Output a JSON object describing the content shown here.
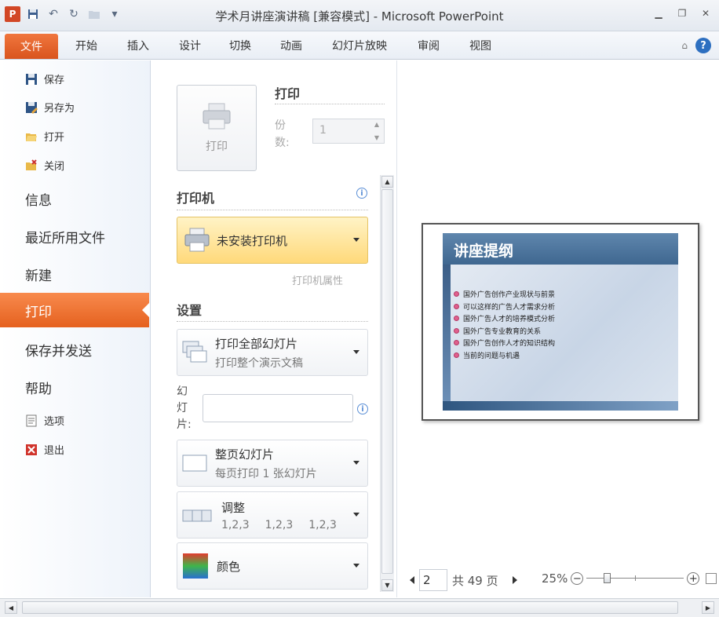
{
  "window": {
    "title": "学术月讲座演讲稿 [兼容模式] - Microsoft PowerPoint",
    "logo_letter": "P"
  },
  "ribbon": {
    "tabs": [
      "文件",
      "开始",
      "插入",
      "设计",
      "切换",
      "动画",
      "幻灯片放映",
      "审阅",
      "视图"
    ]
  },
  "nav": {
    "save": "保存",
    "save_as": "另存为",
    "open": "打开",
    "close": "关闭",
    "info": "信息",
    "recent": "最近所用文件",
    "new": "新建",
    "print": "打印",
    "save_send": "保存并发送",
    "help": "帮助",
    "options": "选项",
    "exit": "退出"
  },
  "print": {
    "button_label": "打印",
    "section_title": "打印",
    "copies_label": "份数:",
    "copies_value": "1",
    "printer_title": "打印机",
    "printer_name": "未安装打印机",
    "printer_props": "打印机属性",
    "settings_title": "设置",
    "range_l1": "打印全部幻灯片",
    "range_l2": "打印整个演示文稿",
    "slides_label": "幻灯片:",
    "slides_value": "",
    "layout_l1": "整页幻灯片",
    "layout_l2": "每页打印 1 张幻灯片",
    "collate_l1": "调整",
    "collate_seq": [
      "1,2,3",
      "1,2,3",
      "1,2,3"
    ],
    "color_l1": "颜色"
  },
  "preview": {
    "slide_title": "讲座提纲",
    "bullets": [
      "国外广告创作产业现状与前景",
      "可以这样的广告人才需求分析",
      "国外广告人才的培养模式分析",
      "国外广告专业教育的关系",
      "国外广告创作人才的知识结构",
      "当前的问题与机遇"
    ],
    "current_page": "2",
    "total_pages": "共 49 页",
    "zoom": "25%",
    "zoom_fraction": 0.25
  },
  "colors": {
    "file_tab": "#e05a22",
    "printer_highlight": "#ffd97a",
    "slide_title_bg": "#4a729a"
  },
  "icons": {
    "save": "save-icon",
    "save_as": "save-as-icon",
    "open": "folder-open-icon",
    "close": "folder-close-icon",
    "options": "options-icon",
    "exit": "exit-icon"
  }
}
